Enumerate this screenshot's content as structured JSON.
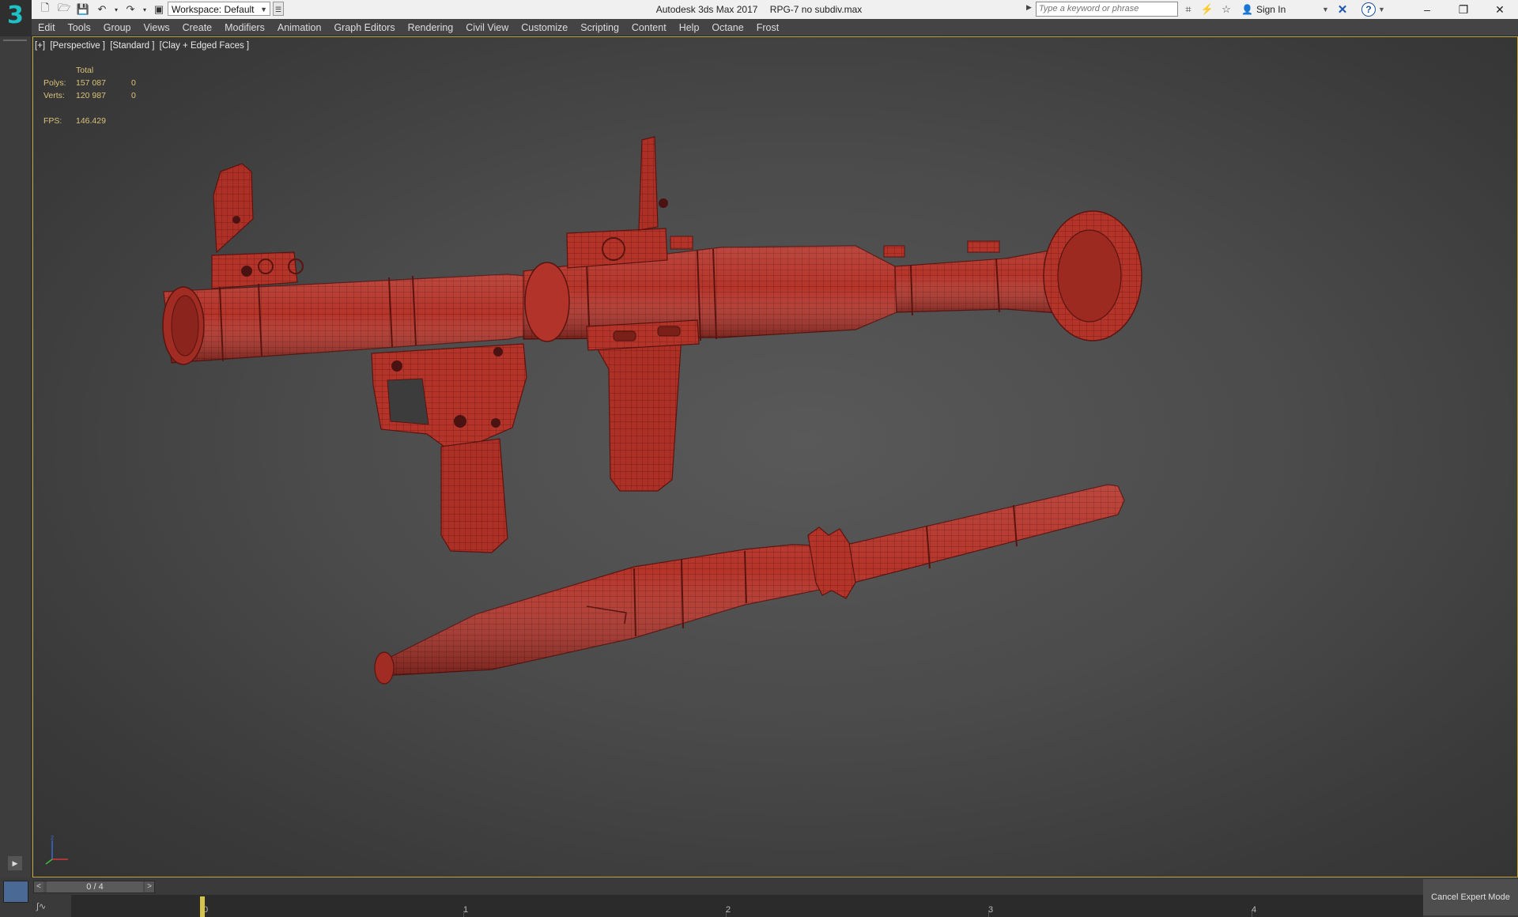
{
  "app": {
    "title": "Autodesk 3ds Max 2017",
    "file": "RPG-7 no subdiv.max",
    "logo": "3"
  },
  "toolbar": {
    "workspace_label": "Workspace: Default"
  },
  "search": {
    "placeholder": "Type a keyword or phrase"
  },
  "account": {
    "sign_in": "Sign In"
  },
  "menu": [
    "Edit",
    "Tools",
    "Group",
    "Views",
    "Create",
    "Modifiers",
    "Animation",
    "Graph Editors",
    "Rendering",
    "Civil View",
    "Customize",
    "Scripting",
    "Content",
    "Help",
    "Octane",
    "Frost"
  ],
  "viewport": {
    "label_parts": [
      "[+]",
      "[Perspective ]",
      "[Standard ]",
      "[Clay + Edged Faces ]"
    ],
    "stats": {
      "header": "Total",
      "polys_label": "Polys:",
      "polys_total": "157 087",
      "polys_sel": "0",
      "verts_label": "Verts:",
      "verts_total": "120 987",
      "verts_sel": "0",
      "fps_label": "FPS:",
      "fps": "146.429"
    },
    "model_color": "#b5342a",
    "wire_color": "#5a1410"
  },
  "timeline": {
    "frame_display": "0 / 4",
    "prev": "<",
    "next": ">",
    "ticks": [
      "0",
      "1",
      "2",
      "3",
      "4"
    ],
    "slider_color": "#d6c44a"
  },
  "expert_mode": {
    "cancel_label": "Cancel Expert Mode"
  }
}
